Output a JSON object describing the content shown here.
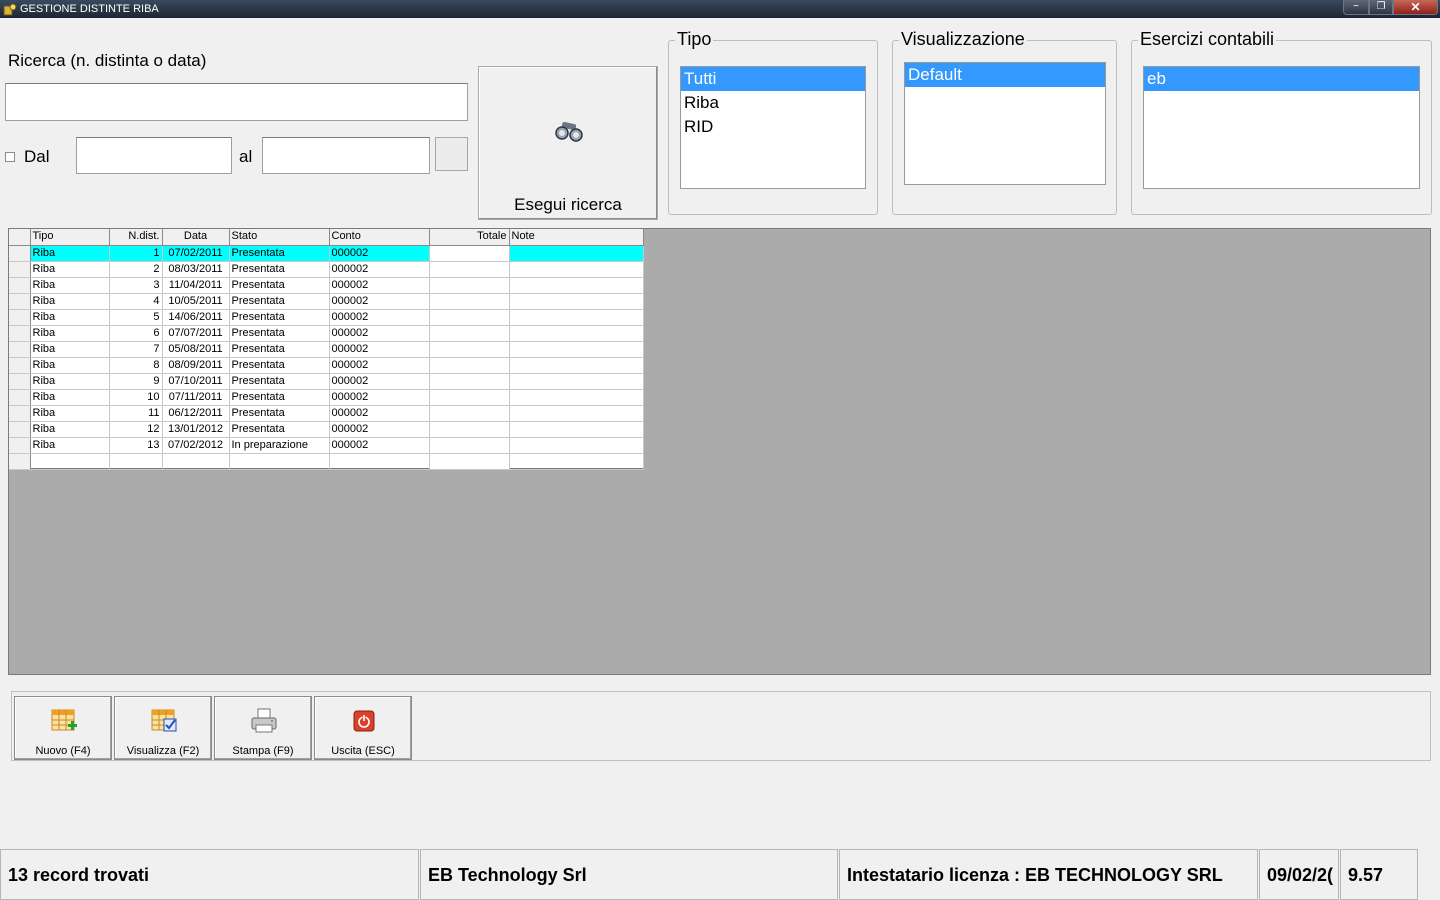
{
  "window": {
    "title": "GESTIONE DISTINTE RIBA",
    "controls": {
      "minimize": "−",
      "restore": "❐",
      "close": "✕"
    }
  },
  "search": {
    "label": "Ricerca (n. distinta o data)",
    "value": "",
    "dal_label": "Dal",
    "dal_checked": false,
    "date_from": "",
    "al_label": "al",
    "date_to": "",
    "button_label": "Esegui ricerca"
  },
  "tipo": {
    "title": "Tipo",
    "items": [
      {
        "label": "Tutti",
        "selected": true
      },
      {
        "label": "Riba",
        "selected": false
      },
      {
        "label": "RID",
        "selected": false
      }
    ]
  },
  "visualizzazione": {
    "title": "Visualizzazione",
    "items": [
      {
        "label": "Default",
        "selected": true
      }
    ]
  },
  "esercizi": {
    "title": "Esercizi contabili",
    "items": [
      {
        "label": "eb",
        "selected": true
      }
    ]
  },
  "grid": {
    "columns": [
      "Tipo",
      "N.dist.",
      "Data",
      "Stato",
      "Conto",
      "Totale",
      "Note"
    ],
    "rows": [
      {
        "tipo": "Riba",
        "n": "1",
        "data": "07/02/2011",
        "stato": "Presentata",
        "conto": "000002",
        "note": "",
        "selected": true
      },
      {
        "tipo": "Riba",
        "n": "2",
        "data": "08/03/2011",
        "stato": "Presentata",
        "conto": "000002",
        "note": ""
      },
      {
        "tipo": "Riba",
        "n": "3",
        "data": "11/04/2011",
        "stato": "Presentata",
        "conto": "000002",
        "note": ""
      },
      {
        "tipo": "Riba",
        "n": "4",
        "data": "10/05/2011",
        "stato": "Presentata",
        "conto": "000002",
        "note": ""
      },
      {
        "tipo": "Riba",
        "n": "5",
        "data": "14/06/2011",
        "stato": "Presentata",
        "conto": "000002",
        "note": ""
      },
      {
        "tipo": "Riba",
        "n": "6",
        "data": "07/07/2011",
        "stato": "Presentata",
        "conto": "000002",
        "note": ""
      },
      {
        "tipo": "Riba",
        "n": "7",
        "data": "05/08/2011",
        "stato": "Presentata",
        "conto": "000002",
        "note": ""
      },
      {
        "tipo": "Riba",
        "n": "8",
        "data": "08/09/2011",
        "stato": "Presentata",
        "conto": "000002",
        "note": ""
      },
      {
        "tipo": "Riba",
        "n": "9",
        "data": "07/10/2011",
        "stato": "Presentata",
        "conto": "000002",
        "note": ""
      },
      {
        "tipo": "Riba",
        "n": "10",
        "data": "07/11/2011",
        "stato": "Presentata",
        "conto": "000002",
        "note": ""
      },
      {
        "tipo": "Riba",
        "n": "11",
        "data": "06/12/2011",
        "stato": "Presentata",
        "conto": "000002",
        "note": ""
      },
      {
        "tipo": "Riba",
        "n": "12",
        "data": "13/01/2012",
        "stato": "Presentata",
        "conto": "000002",
        "note": ""
      },
      {
        "tipo": "Riba",
        "n": "13",
        "data": "07/02/2012",
        "stato": "In preparazione",
        "conto": "000002",
        "note": ""
      }
    ]
  },
  "toolbar": {
    "nuovo": "Nuovo (F4)",
    "visualizza": "Visualizza (F2)",
    "stampa": "Stampa (F9)",
    "uscita": "Uscita (ESC)"
  },
  "status": {
    "records": "13 record trovati",
    "company": "EB Technology Srl",
    "license": "Intestatario licenza : EB TECHNOLOGY SRL",
    "date": "09/02/2(",
    "version": "9.57"
  },
  "colors": {
    "selection": "#3399ff",
    "grid_selection": "#00ffff",
    "grid_background": "#ababab"
  }
}
